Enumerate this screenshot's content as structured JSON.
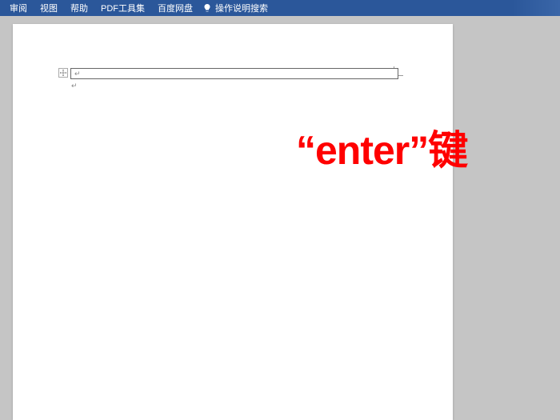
{
  "menu": {
    "items": [
      "审阅",
      "视图",
      "帮助",
      "PDF工具集",
      "百度网盘"
    ],
    "search_hint": "操作说明搜索"
  },
  "document": {
    "paragraph_mark": "↵"
  },
  "annotation": {
    "text": "“enter”键"
  }
}
